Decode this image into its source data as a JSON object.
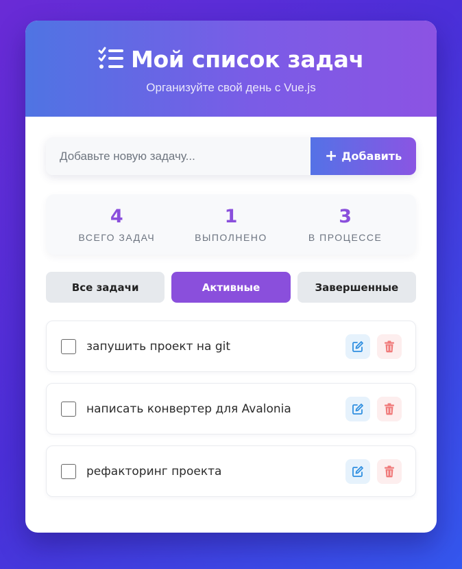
{
  "header": {
    "title": "Мой список задач",
    "subtitle": "Организуйте свой день с Vue.js",
    "icon": "task-list-icon"
  },
  "add_task": {
    "placeholder": "Добавьте новую задачу...",
    "value": "",
    "button_label": "Добавить",
    "button_icon": "plus-icon"
  },
  "stats": [
    {
      "value": "4",
      "label": "ВСЕГО ЗАДАЧ"
    },
    {
      "value": "1",
      "label": "ВЫПОЛНЕНО"
    },
    {
      "value": "3",
      "label": "В ПРОЦЕССЕ"
    }
  ],
  "filters": [
    {
      "label": "Все задачи",
      "active": false
    },
    {
      "label": "Активные",
      "active": true
    },
    {
      "label": "Завершенные",
      "active": false
    }
  ],
  "tasks": [
    {
      "text": "запушить проект на git",
      "completed": false
    },
    {
      "text": "написать конвертер для Avalonia",
      "completed": false
    },
    {
      "text": "рефакторинг проекта",
      "completed": false
    }
  ],
  "colors": {
    "accent": "#8a4fdc",
    "header_gradient_start": "#4f74e3",
    "header_gradient_end": "#8c53e3",
    "edit": "#2f8fe0",
    "delete": "#f07a7a"
  }
}
